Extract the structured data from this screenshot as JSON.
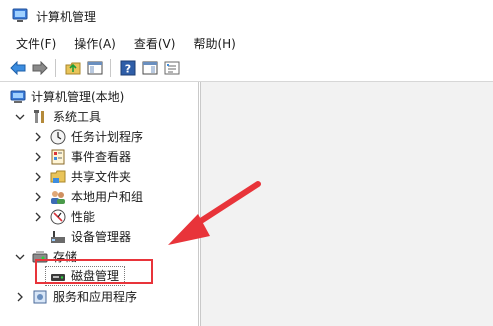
{
  "window": {
    "title": "计算机管理"
  },
  "menu": [
    {
      "label": "文件(F)"
    },
    {
      "label": "操作(A)"
    },
    {
      "label": "查看(V)"
    },
    {
      "label": "帮助(H)"
    }
  ],
  "toolbar": {
    "buttons": [
      "back-icon",
      "forward-icon",
      "up-folder-icon",
      "show-hide-tree-icon",
      "help-icon",
      "properties-icon",
      "export-list-icon"
    ]
  },
  "tree": {
    "root": "计算机管理(本地)",
    "system_tools": "系统工具",
    "task_scheduler": "任务计划程序",
    "event_viewer": "事件查看器",
    "shared_folders": "共享文件夹",
    "local_users": "本地用户和组",
    "performance": "性能",
    "device_manager": "设备管理器",
    "storage": "存储",
    "disk_management": "磁盘管理",
    "services_apps": "服务和应用程序"
  },
  "colors": {
    "callout": "#e8343a",
    "right_pane_bg": "#f2f2f2"
  }
}
